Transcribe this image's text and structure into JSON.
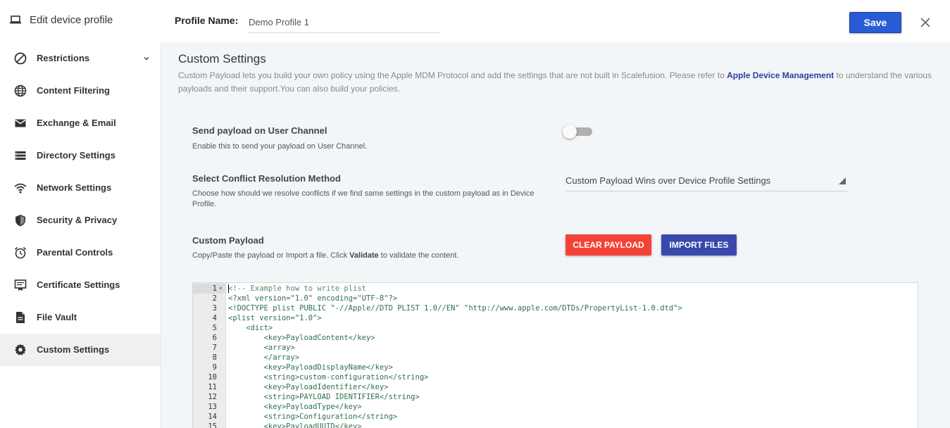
{
  "header": {
    "title": "Edit device profile",
    "profile_name_label": "Profile Name:",
    "profile_name_value": "Demo Profile 1",
    "save_label": "Save"
  },
  "sidebar": {
    "items": [
      {
        "label": "Restrictions",
        "icon": "block-icon",
        "expandable": true
      },
      {
        "label": "Content Filtering",
        "icon": "globe-icon"
      },
      {
        "label": "Exchange & Email",
        "icon": "mail-icon"
      },
      {
        "label": "Directory Settings",
        "icon": "list-icon"
      },
      {
        "label": "Network Settings",
        "icon": "wifi-icon"
      },
      {
        "label": "Security & Privacy",
        "icon": "shield-icon"
      },
      {
        "label": "Parental Controls",
        "icon": "alarm-icon"
      },
      {
        "label": "Certificate Settings",
        "icon": "certificate-icon"
      },
      {
        "label": "File Vault",
        "icon": "file-icon"
      },
      {
        "label": "Custom Settings",
        "icon": "gear-icon",
        "active": true
      }
    ]
  },
  "main": {
    "title": "Custom Settings",
    "description_before": "Custom Payload lets you build your own policy using the Apple MDM Protocol and add the settings that are not built in Scalefusion. Please refer to ",
    "description_link": "Apple Device Management",
    "description_after": " to understand the various payloads and their support.You can also build your policies.",
    "user_channel": {
      "title": "Send payload on User Channel",
      "subtitle": "Enable this to send your payload on User Channel.",
      "enabled": false
    },
    "conflict": {
      "title": "Select Conflict Resolution Method",
      "subtitle": "Choose how should we resolve conflicts if we find same settings in the custom payload as in Device Profile.",
      "selected": "Custom Payload Wins over Device Profile Settings"
    },
    "payload": {
      "title": "Custom Payload",
      "subtitle_before": "Copy/Paste the payload or Import a file. Click ",
      "subtitle_bold": "Validate",
      "subtitle_after": " to validate the content.",
      "clear_label": "CLEAR PAYLOAD",
      "import_label": "IMPORT FILES"
    },
    "editor": {
      "lines": [
        "<!-- Example how to write plist",
        "<?xml version=\"1.0\" encoding=\"UTF-8\"?>",
        "<!DOCTYPE plist PUBLIC \"-//Apple//DTD PLIST 1.0//EN\" \"http://www.apple.com/DTDs/PropertyList-1.0.dtd\">",
        "<plist version=\"1.0\">",
        "    <dict>",
        "        <key>PayloadContent</key>",
        "        <array>",
        "        </array>",
        "        <key>PayloadDisplayName</key>",
        "        <string>custom-configuration</string>",
        "        <key>PayloadIdentifier</key>",
        "        <string>PAYLOAD IDENTIFIER</string>",
        "        <key>PayloadType</key>",
        "        <string>Configuration</string>",
        "        <key>PayloadUUID</key>"
      ]
    }
  },
  "colors": {
    "save": "#2a5bd7",
    "clear": "#f44336",
    "import": "#3949ab",
    "link": "#2c3e9e"
  }
}
